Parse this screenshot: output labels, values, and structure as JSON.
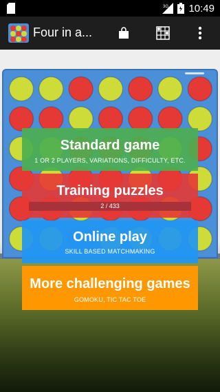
{
  "status_bar": {
    "time": "10:49",
    "network": "3G",
    "icons": [
      "sd-card-icon",
      "signal-icon",
      "battery-icon"
    ]
  },
  "action_bar": {
    "title": "Four in a...",
    "icons": [
      "app-logo-icon",
      "shop-bag-icon",
      "puzzle-grid-icon",
      "overflow-menu-icon"
    ]
  },
  "board": {
    "rows": [
      [
        "Y",
        "Y",
        "R",
        "Y",
        "R",
        "Y",
        "R"
      ],
      [
        "R",
        "R",
        "Y",
        "R",
        "R",
        "R",
        "Y"
      ],
      [
        "Y",
        "Y",
        "R",
        "R",
        "R",
        "Y",
        "R"
      ],
      [
        "R",
        "Y",
        "R",
        "R",
        "Y",
        "R",
        "Y"
      ],
      [
        "R",
        "R",
        "Y",
        "R",
        "R",
        "Y",
        "R"
      ],
      [
        "Y",
        "Y",
        "B",
        "Y",
        "Y",
        "Y",
        "Y"
      ]
    ],
    "colors": {
      "Y": "#cddc39",
      "R": "#e53935",
      "B": "#3e7fd0",
      "frame": "#4a8fd8"
    }
  },
  "menu": {
    "standard": {
      "label": "Standard game",
      "sub": "1 OR 2 PLAYERS, VARIATIONS, DIFFICULTY, ETC.",
      "color": "#4caf50"
    },
    "training": {
      "label": "Training puzzles",
      "progress_text": "2 / 433",
      "progress": 0.0046,
      "color": "#e53935"
    },
    "online": {
      "label": "Online play",
      "sub": "SKILL BASED MATCHMAKING",
      "color": "#2196f3"
    },
    "more": {
      "label": "More challenging games",
      "sub": "GOMOKU, TIC TAC TOE",
      "color": "#ff9800"
    }
  }
}
